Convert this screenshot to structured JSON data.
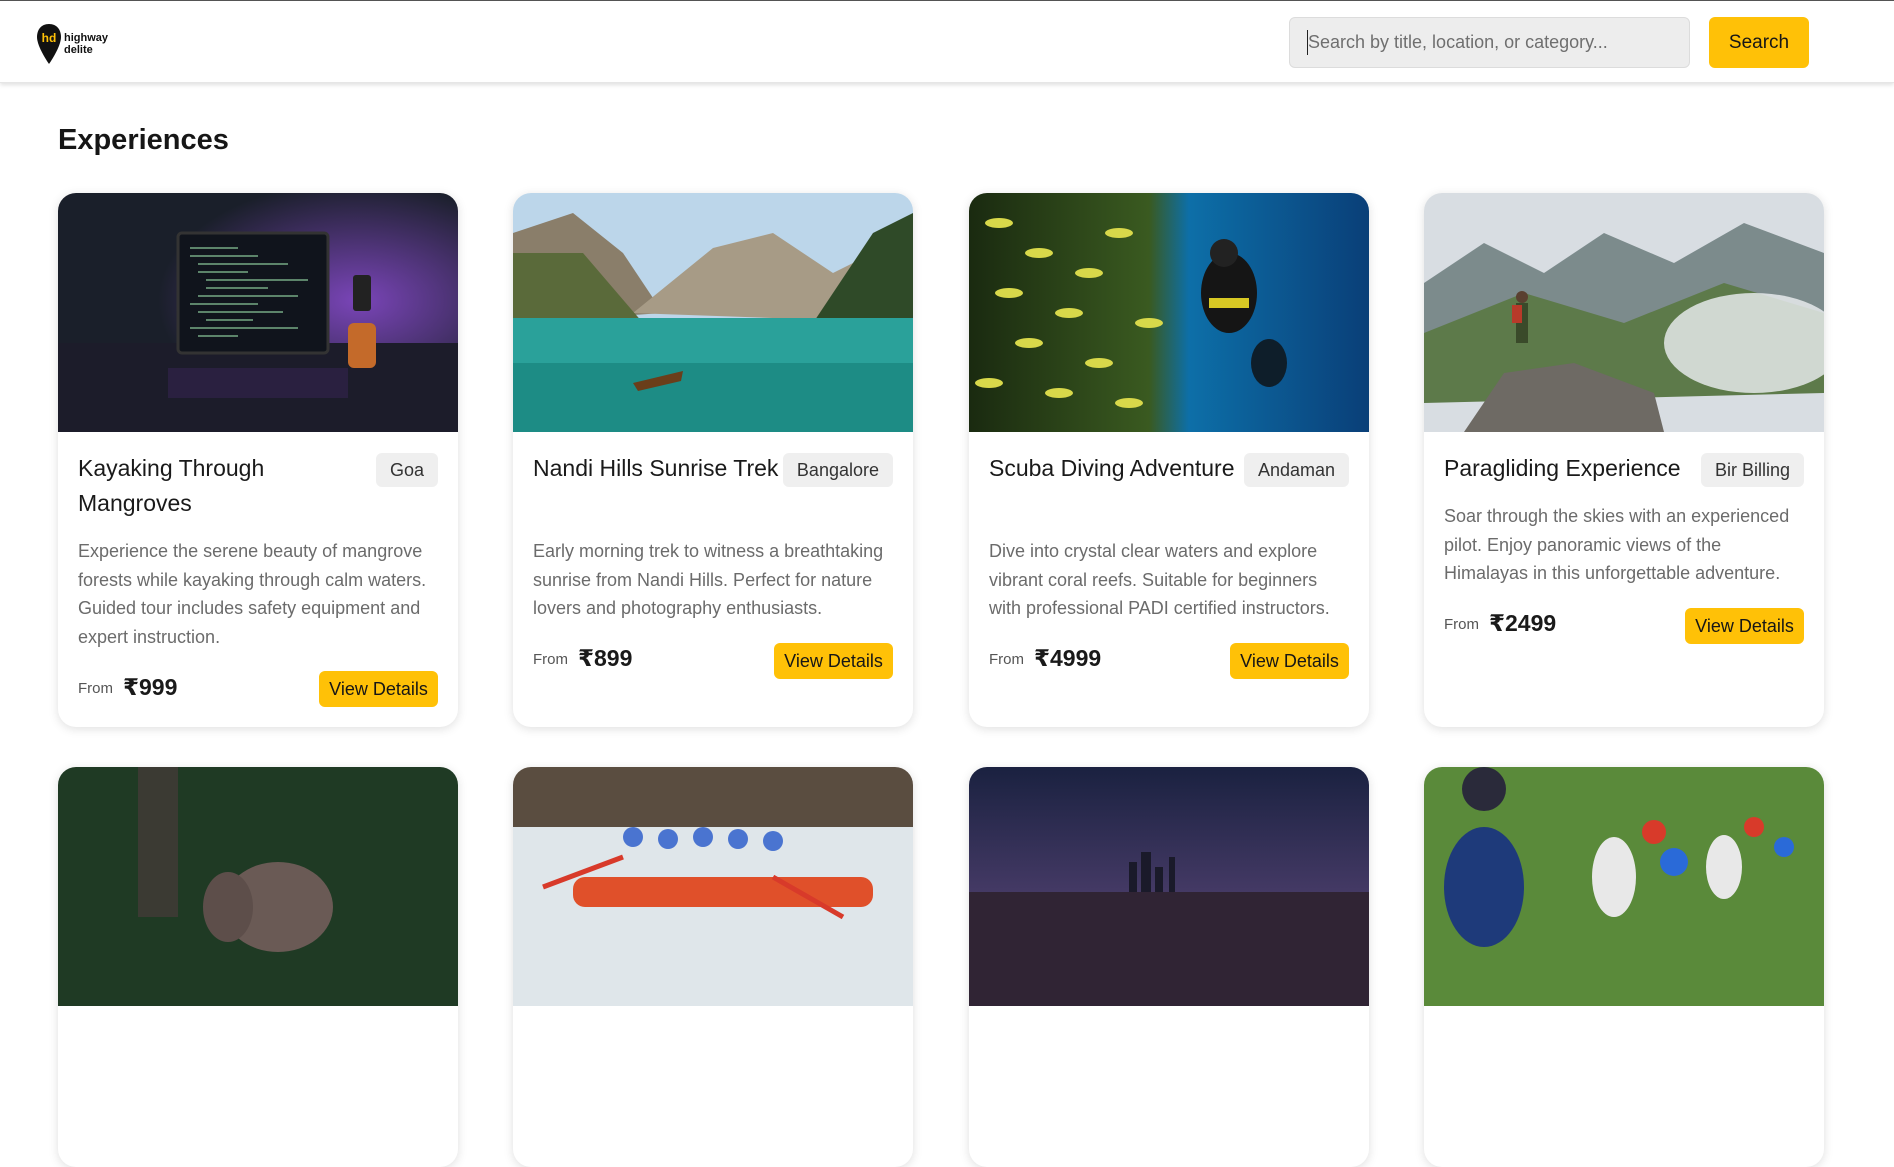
{
  "header": {
    "logo_line1": "highway",
    "logo_line2": "delite",
    "search_placeholder": "Search by title, location, or category...",
    "search_value": "",
    "search_button": "Search"
  },
  "main": {
    "title": "Experiences",
    "price_prefix": "From",
    "details_label": "View Details",
    "cards": [
      {
        "title": "Kayaking Through Mangroves",
        "location": "Goa",
        "description": "Experience the serene beauty of mangrove forests while kayaking through calm waters. Guided tour includes safety equipment and expert instruction.",
        "price": "₹999"
      },
      {
        "title": "Nandi Hills Sunrise Trek",
        "location": "Bangalore",
        "description": "Early morning trek to witness a breathtaking sunrise from Nandi Hills. Perfect for nature lovers and photography enthusiasts.",
        "price": "₹899"
      },
      {
        "title": "Scuba Diving Adventure",
        "location": "Andaman",
        "description": "Dive into crystal clear waters and explore vibrant coral reefs. Suitable for beginners with professional PADI certified instructors.",
        "price": "₹4999"
      },
      {
        "title": "Paragliding Experience",
        "location": "Bir Billing",
        "description": "Soar through the skies with an experienced pilot. Enjoy panoramic views of the Himalayas in this unforgettable adventure.",
        "price": "₹2499"
      }
    ]
  },
  "colors": {
    "accent": "#FFC107",
    "badge_bg": "#EFEFEF",
    "search_bg": "#EDEDED",
    "text_primary": "#161616",
    "text_muted": "#6B6B6B"
  }
}
